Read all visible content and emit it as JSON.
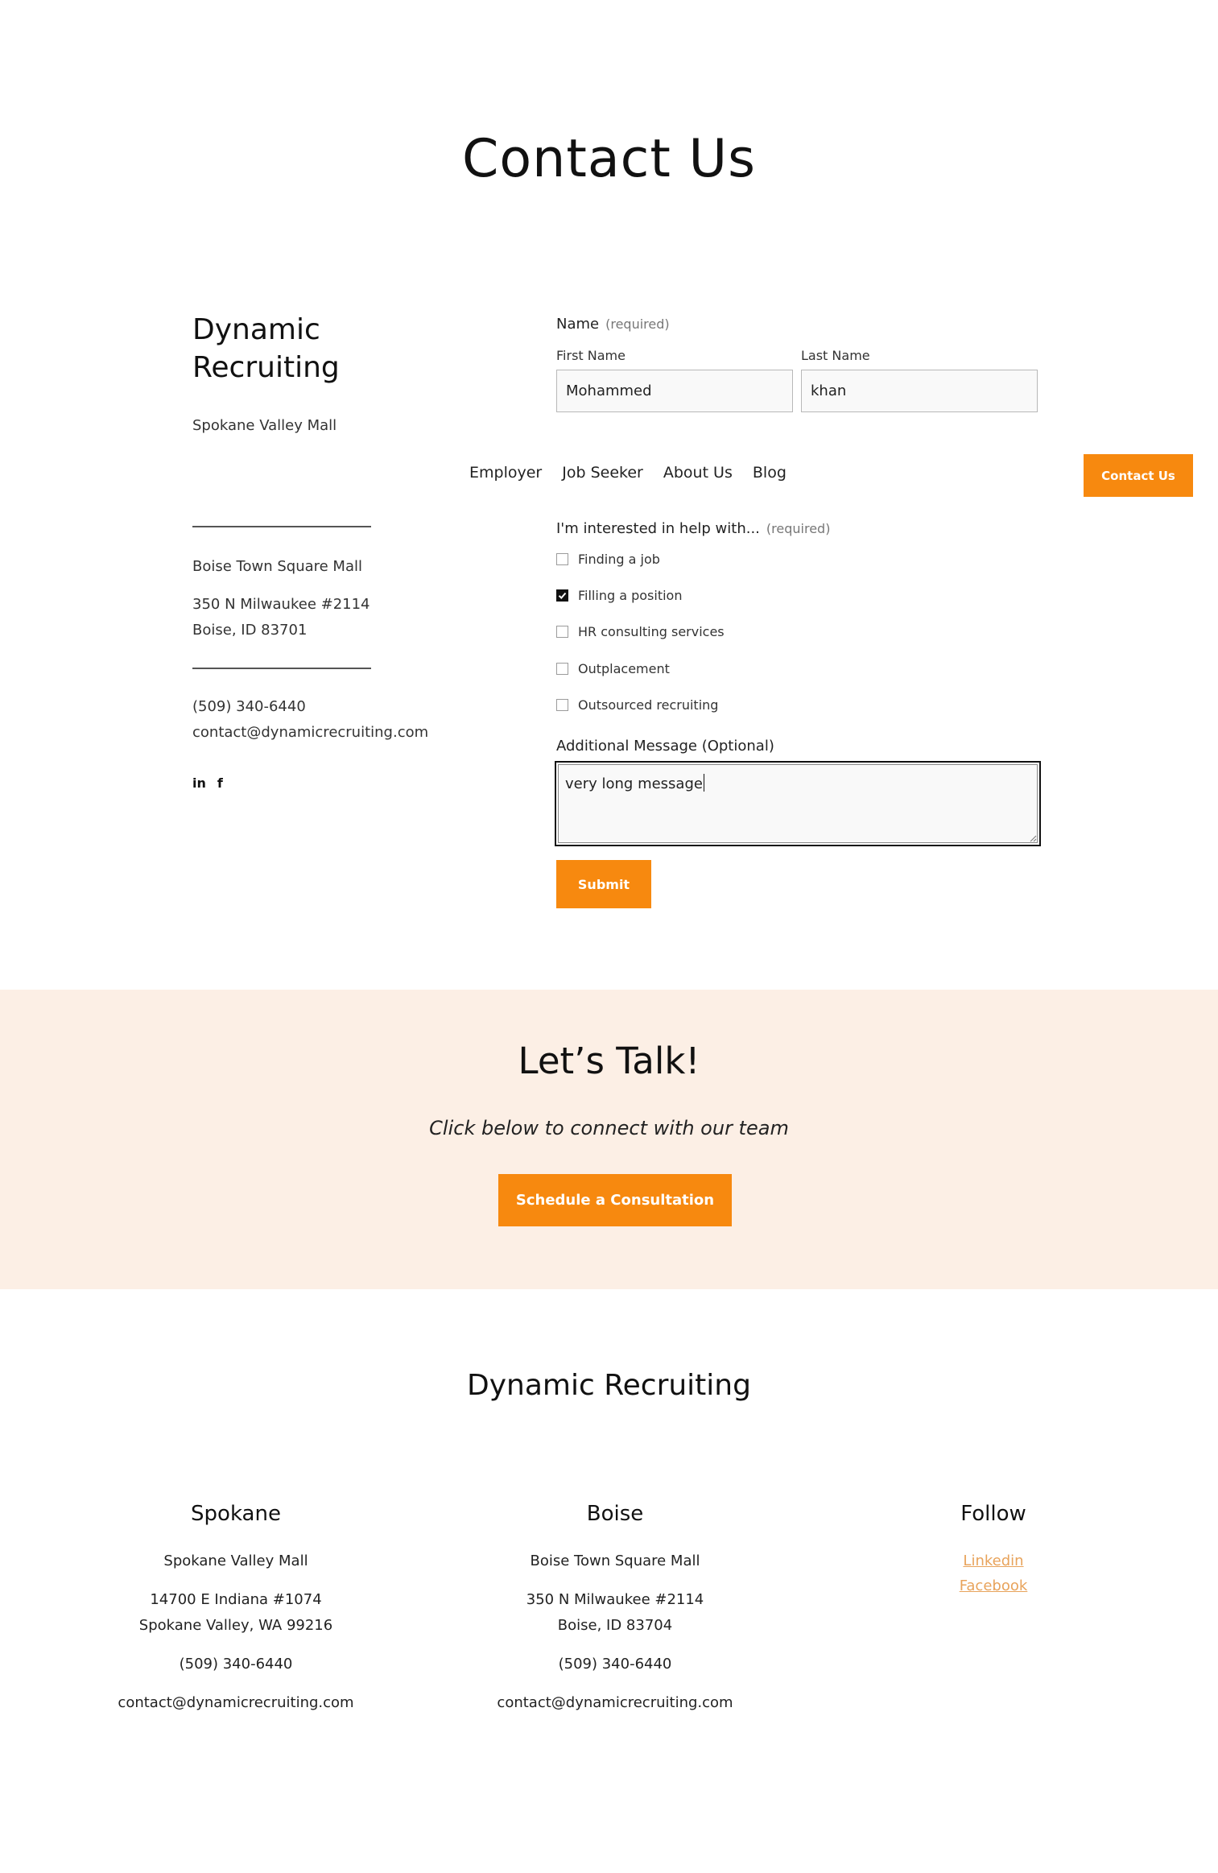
{
  "page": {
    "title": "Contact Us"
  },
  "brand": {
    "name": "Dynamic Recruiting"
  },
  "left": {
    "location1": "Spokane Valley Mall",
    "location2": "Boise Town Square Mall",
    "address_line1": "350 N Milwaukee #2114",
    "address_line2": "Boise, ID 83701",
    "phone": "(509) 340-6440",
    "email": "contact@dynamicrecruiting.com"
  },
  "nav": {
    "items": [
      "Employer",
      "Job Seeker",
      "About Us",
      "Blog"
    ],
    "cta": "Contact Us"
  },
  "form": {
    "name_label": "Name",
    "required_tag": "(required)",
    "first_name_label": "First Name",
    "first_name_value": "Mohammed",
    "last_name_label": "Last Name",
    "last_name_value": "khan",
    "interest_label": "I'm interested in help with...",
    "options": [
      {
        "label": "Finding a job",
        "checked": false
      },
      {
        "label": "Filling a position",
        "checked": true
      },
      {
        "label": "HR consulting services",
        "checked": false
      },
      {
        "label": "Outplacement",
        "checked": false
      },
      {
        "label": "Outsourced recruiting",
        "checked": false
      }
    ],
    "message_label": "Additional Message (Optional)",
    "message_value": "very long message",
    "submit_label": "Submit"
  },
  "talk": {
    "title": "Let’s Talk!",
    "subtitle": "Click below to connect with our team",
    "button": "Schedule a Consultation"
  },
  "footer": {
    "title": "Dynamic Recruiting",
    "spokane": {
      "heading": "Spokane",
      "location": "Spokane Valley Mall",
      "address_line1": "14700 E Indiana #1074",
      "address_line2": "Spokane Valley, WA 99216",
      "phone": "(509) 340-6440",
      "email": "contact@dynamicrecruiting.com"
    },
    "boise": {
      "heading": "Boise",
      "location": "Boise Town Square Mall",
      "address_line1": "350 N Milwaukee #2114",
      "address_line2": "Boise, ID 83704",
      "phone": "(509) 340-6440",
      "email": "contact@dynamicrecruiting.com"
    },
    "follow": {
      "heading": "Follow",
      "links": [
        "Linkedin",
        "Facebook"
      ]
    }
  },
  "colors": {
    "accent": "#f7890f",
    "talk_bg": "#fcefe5",
    "link": "#e8a35b"
  },
  "icons": {
    "social": [
      "linkedin-icon",
      "facebook-icon"
    ]
  }
}
